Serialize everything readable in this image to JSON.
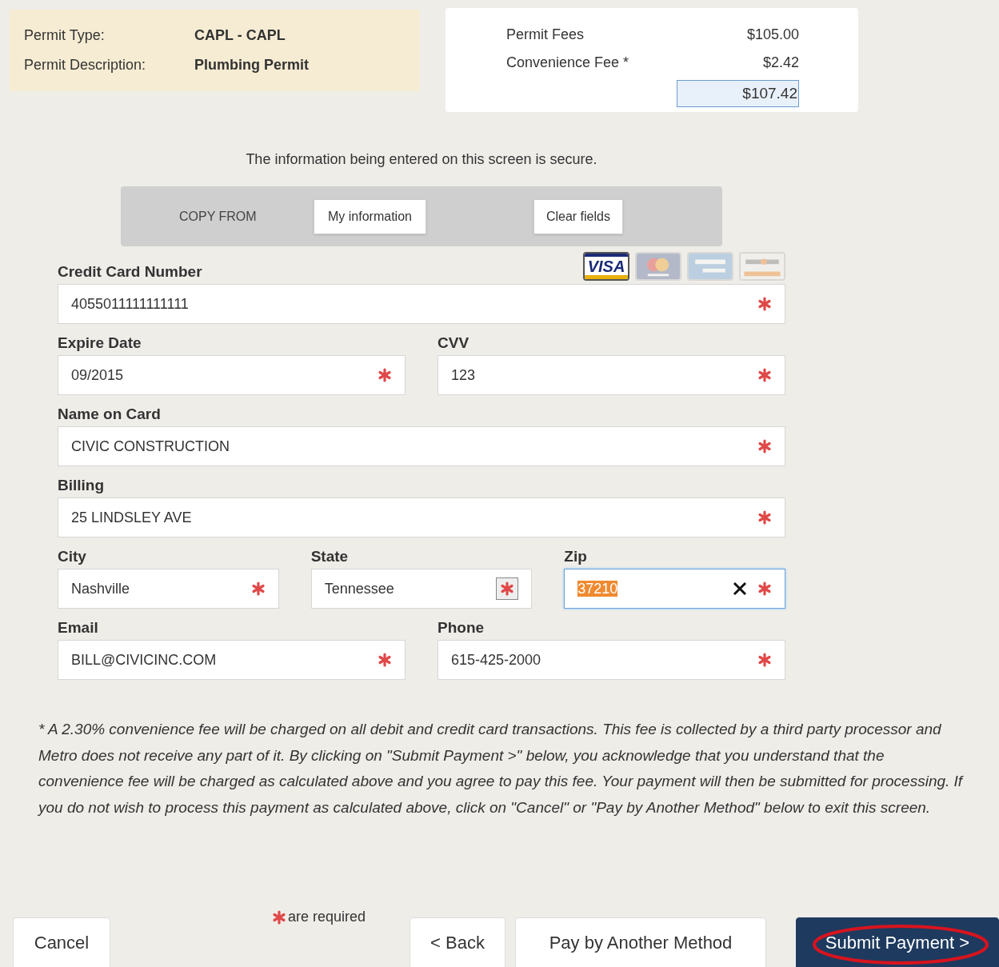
{
  "permit": {
    "rows": [
      {
        "label": "Permit Type:",
        "value": "CAPL - CAPL"
      },
      {
        "label": "Permit Description:",
        "value": "Plumbing Permit"
      }
    ]
  },
  "fees": {
    "rows": [
      {
        "label": "Permit Fees",
        "amount": "$105.00"
      },
      {
        "label": "Convenience Fee *",
        "amount": "$2.42"
      }
    ],
    "total": "$107.42"
  },
  "secure_notice": "The information being entered on this screen is secure.",
  "copy_from": {
    "label": "COPY FROM",
    "buttons": [
      "My information",
      "Clear fields"
    ]
  },
  "cards": [
    {
      "kind": "visa",
      "label": "VISA",
      "selected": true
    },
    {
      "kind": "mastercard",
      "selected": false
    },
    {
      "kind": "amex",
      "selected": false
    },
    {
      "kind": "discover",
      "selected": false
    }
  ],
  "field_rows": [
    [
      {
        "label": "Credit Card Number",
        "value": "4055011111111111",
        "kind": "text",
        "focused": false
      }
    ],
    [
      {
        "label": "Expire Date",
        "value": "09/2015",
        "kind": "text",
        "focused": false
      },
      {
        "label": "CVV",
        "value": "123",
        "kind": "text",
        "focused": false
      }
    ],
    [
      {
        "label": "Name on Card",
        "value": "CIVIC CONSTRUCTION",
        "kind": "text",
        "focused": false
      }
    ],
    [
      {
        "label": "Billing",
        "value": "25 LINDSLEY AVE",
        "kind": "text",
        "focused": false
      }
    ],
    [
      {
        "label": "City",
        "value": "Nashville",
        "kind": "text",
        "focused": false
      },
      {
        "label": "State",
        "value": "Tennessee",
        "kind": "select",
        "focused": false
      },
      {
        "label": "Zip",
        "value": "37210",
        "kind": "text",
        "focused": true
      }
    ],
    [
      {
        "label": "Email",
        "value": "BILL@CIVICINC.COM",
        "kind": "text",
        "focused": false
      },
      {
        "label": "Phone",
        "value": "615-425-2000",
        "kind": "text",
        "focused": false
      }
    ]
  ],
  "fee_note": "* A 2.30% convenience fee will be charged on all debit and credit card transactions. This fee is collected by a third party processor and Metro does not receive any part of it. By clicking on \"Submit Payment >\" below, you acknowledge that you understand that the convenience fee will be charged as calculated above and you agree to pay this fee. Your payment will then be submitted for processing. If you do not wish to process this payment as calculated above, click on \"Cancel\" or \"Pay by Another Method\" below to exit this screen.",
  "buttons": [
    {
      "label": "Cancel",
      "kind": "plain",
      "annotated": false
    },
    {
      "label": "< Back",
      "kind": "plain",
      "annotated": false
    },
    {
      "label": "Pay by Another Method",
      "kind": "plain",
      "annotated": false
    },
    {
      "label": "Submit Payment >",
      "kind": "primary",
      "annotated": true
    }
  ],
  "required_note": "are required"
}
